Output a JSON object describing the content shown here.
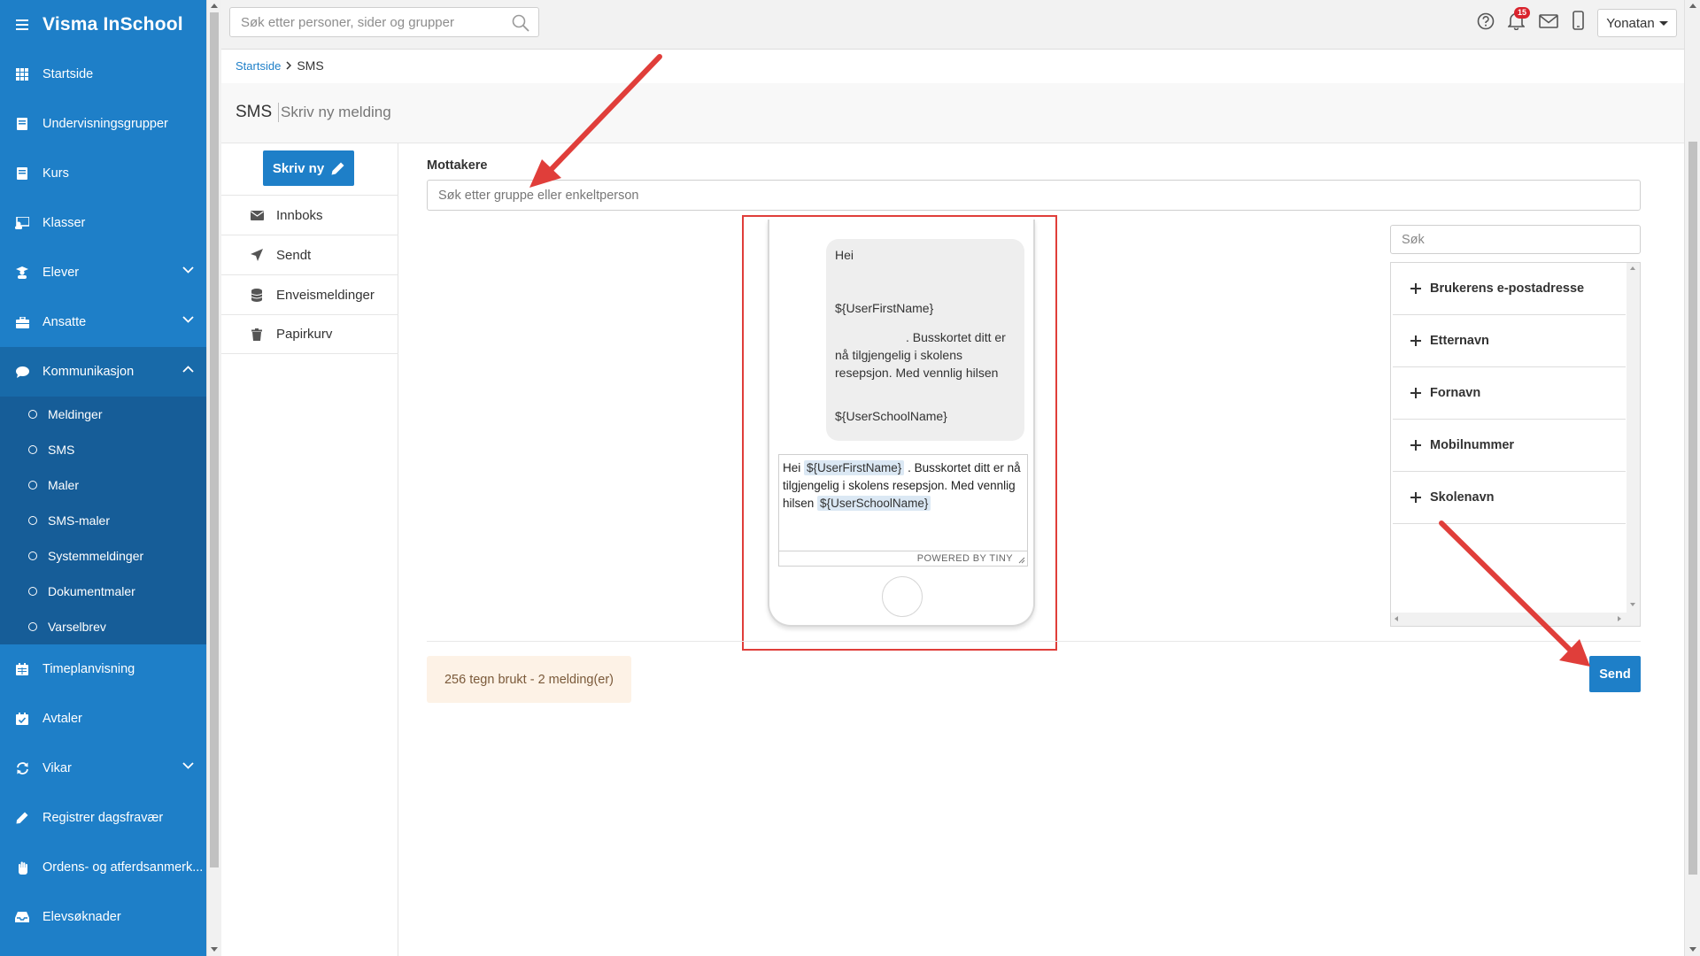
{
  "app": {
    "title": "Visma InSchool"
  },
  "sidebar": {
    "items": [
      {
        "label": "Startside",
        "icon": "grid-icon"
      },
      {
        "label": "Undervisningsgrupper",
        "icon": "book-icon"
      },
      {
        "label": "Kurs",
        "icon": "book-icon"
      },
      {
        "label": "Klasser",
        "icon": "classroom-icon"
      },
      {
        "label": "Elever",
        "icon": "student-icon"
      },
      {
        "label": "Ansatte",
        "icon": "briefcase-icon"
      },
      {
        "label": "Kommunikasjon",
        "icon": "chat-icon"
      },
      {
        "label": "Timeplanvisning",
        "icon": "calendar-icon"
      },
      {
        "label": "Avtaler",
        "icon": "calendar-check-icon"
      },
      {
        "label": "Vikar",
        "icon": "swap-icon"
      },
      {
        "label": "Registrer dagsfravær",
        "icon": "pencil-icon"
      },
      {
        "label": "Ordens- og atferdsanmerk...",
        "icon": "hand-icon"
      },
      {
        "label": "Elevsøknader",
        "icon": "inbox-icon"
      }
    ],
    "sub_items": [
      "Meldinger",
      "SMS",
      "Maler",
      "SMS-maler",
      "Systemmeldinger",
      "Dokumentmaler",
      "Varselbrev"
    ]
  },
  "topbar": {
    "search_placeholder": "Søk etter personer, sider og grupper",
    "notification_count": "15",
    "user_name": "Yonatan"
  },
  "breadcrumb": {
    "home": "Startside",
    "current": "SMS"
  },
  "header": {
    "title": "SMS",
    "subtitle": "Skriv ny melding"
  },
  "message_menu": {
    "write_new": "Skriv ny",
    "items": [
      "Innboks",
      "Sendt",
      "Enveismeldinger",
      "Papirkurv"
    ]
  },
  "composer": {
    "recipients_label": "Mottakere",
    "recipients_placeholder": "Søk etter gruppe eller enkeltperson",
    "preview": {
      "line1": "Hei",
      "line2": "${UserFirstName}",
      "line3": ".  Busskortet ditt er nå tilgjengelig i skolens resepsjon. Med vennlig hilsen",
      "line4": "${UserSchoolName}"
    },
    "editor": {
      "greeting": "Hei",
      "tag_first_name": "${UserFirstName}",
      "text": ".  Busskortet ditt er nå tilgjengelig i skolens resepsjon. Med vennlig hilsen",
      "tag_school_name": "${UserSchoolName}",
      "powered_by": "POWERED BY TINY"
    },
    "variables_search_placeholder": "Søk",
    "variables": [
      "Brukerens e-postadresse",
      "Etternavn",
      "Fornavn",
      "Mobilnummer",
      "Skolenavn"
    ],
    "counter": "256 tegn brukt - 2 melding(er)",
    "send_label": "Send"
  },
  "colors": {
    "brand": "#1e7fc8",
    "sidebar_active": "#165d98",
    "annotation_red": "#e03e3a",
    "badge_red": "#d9232d"
  }
}
